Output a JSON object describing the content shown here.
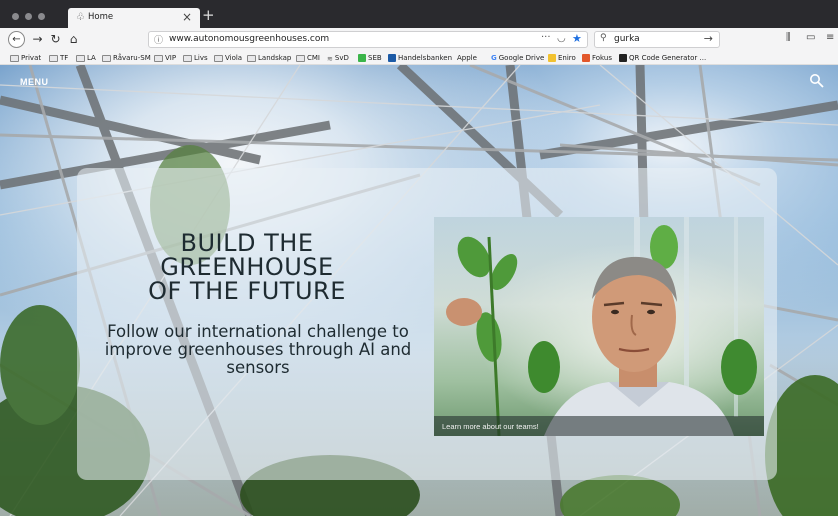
{
  "browser": {
    "tab": {
      "title": "Home"
    },
    "url": "www.autonomousgreenhouses.com",
    "search": {
      "value": "gurka"
    },
    "bookmarks": [
      {
        "label": "Privat",
        "icon": "folder-icon"
      },
      {
        "label": "TF",
        "icon": "folder-icon"
      },
      {
        "label": "LA",
        "icon": "folder-icon"
      },
      {
        "label": "Råvaru-SM",
        "icon": "folder-icon"
      },
      {
        "label": "VIP",
        "icon": "folder-icon"
      },
      {
        "label": "Livs",
        "icon": "folder-icon"
      },
      {
        "label": "Viola",
        "icon": "folder-icon"
      },
      {
        "label": "Landskap",
        "icon": "folder-icon"
      },
      {
        "label": "CMI",
        "icon": "folder-icon"
      },
      {
        "label": "SvD",
        "icon": "svd-icon"
      },
      {
        "label": "SEB",
        "icon": "seb-icon",
        "color": "#3bb54a"
      },
      {
        "label": "Handelsbanken",
        "icon": "handelsbanken-icon",
        "color": "#1c5aa6"
      },
      {
        "label": "Apple",
        "icon": "apple-icon"
      },
      {
        "label": "Google Drive",
        "icon": "google-icon"
      },
      {
        "label": "Eniro",
        "icon": "eniro-icon",
        "color": "#f2c230"
      },
      {
        "label": "Fokus",
        "icon": "fokus-icon",
        "color": "#e2572b"
      },
      {
        "label": "QR Code Generator ...",
        "icon": "qr-icon",
        "color": "#222222"
      }
    ]
  },
  "page": {
    "menu_label": "MENU",
    "hero": {
      "title_lines": [
        "BUILD THE",
        "GREENHOUSE",
        "OF THE FUTURE"
      ],
      "subtitle_lines": [
        "Follow our international challenge to",
        "improve greenhouses through AI and",
        "sensors"
      ]
    },
    "photo": {
      "caption": "Learn more about our teams!"
    }
  },
  "colors": {
    "accent": "#1e6fe0",
    "title_text": "#1e2b31"
  }
}
